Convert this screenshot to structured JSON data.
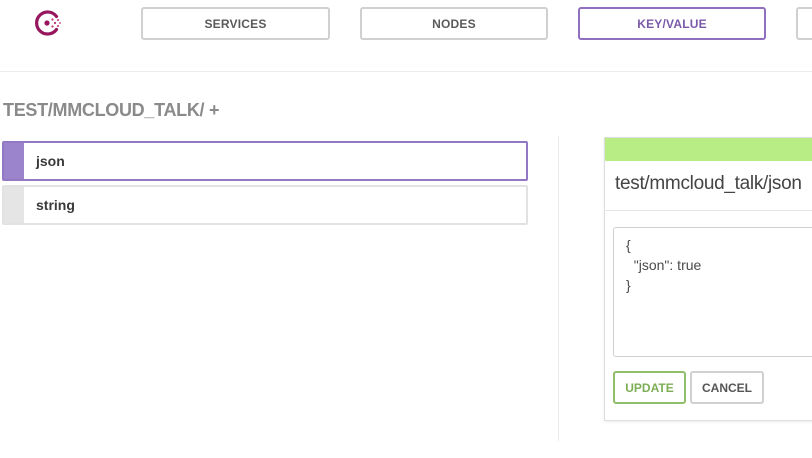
{
  "nav": {
    "items": [
      {
        "label": "SERVICES",
        "active": false
      },
      {
        "label": "NODES",
        "active": false
      },
      {
        "label": "KEY/VALUE",
        "active": true
      },
      {
        "label": "",
        "active": false
      }
    ]
  },
  "breadcrumb": {
    "path": "TEST/MMCLOUD_TALK/",
    "add_label": "+"
  },
  "keys": {
    "items": [
      {
        "label": "json",
        "selected": true
      },
      {
        "label": "string",
        "selected": false
      }
    ]
  },
  "editor": {
    "title": "test/mmcloud_talk/json",
    "value": "{\n  \"json\": true\n}",
    "update_label": "UPDATE",
    "cancel_label": "CANCEL"
  },
  "colors": {
    "accent": "#8f70c0",
    "logo": "#96175d",
    "status_bar": "#b8ec84",
    "update": "#7cae55"
  },
  "icons": {
    "logo": "consul-logo-icon"
  }
}
